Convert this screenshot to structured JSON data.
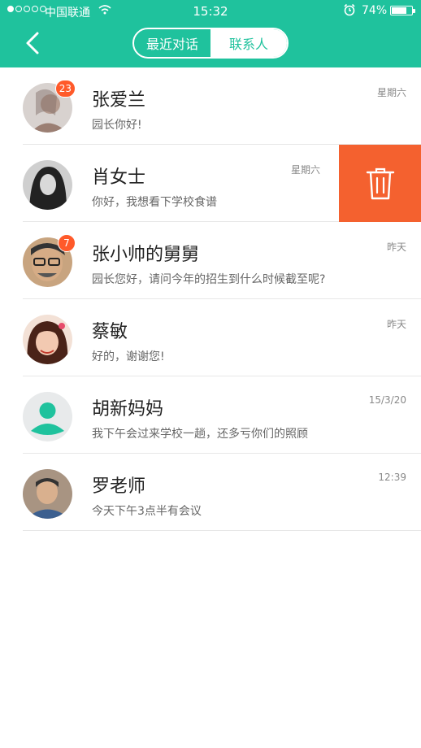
{
  "status_bar": {
    "carrier": "中国联通",
    "time": "15:32",
    "battery": "74%",
    "signal_filled": 1,
    "signal_total": 5
  },
  "header": {
    "back_icon": "chevron-left-icon",
    "tabs": [
      "最近对话",
      "联系人"
    ],
    "active_tab": "联系人"
  },
  "chats": [
    {
      "name": "张爱兰",
      "message": "园长你好!",
      "time": "星期六",
      "badge": "23",
      "avatar_color": "#b9a196"
    },
    {
      "name": "肖女士",
      "message": "你好，我想看下学校食谱",
      "time": "星期六",
      "badge": "",
      "avatar_color": "#3c3c3c"
    },
    {
      "name": "张小帅的舅舅",
      "message": "园长您好，请问今年的招生到什么时候截至呢?",
      "time": "昨天",
      "badge": "7",
      "avatar_color": "#a57858"
    },
    {
      "name": "蔡敏",
      "message": "好的，谢谢您!",
      "time": "昨天",
      "badge": "",
      "avatar_color": "#7a3d2e"
    },
    {
      "name": "胡新妈妈",
      "message": "我下午会过来学校一趟，还多亏你们的照顾",
      "time": "15/3/20",
      "badge": "",
      "avatar_color": "#e8eaeb"
    },
    {
      "name": "罗老师",
      "message": "今天下午3点半有会议",
      "time": "12:39",
      "badge": "",
      "avatar_color": "#8c6a58"
    }
  ],
  "swipe_action": {
    "icon": "trash-icon",
    "color": "#f4612f"
  },
  "colors": {
    "primary": "#1fc29d",
    "badge": "#ff5a2a"
  }
}
